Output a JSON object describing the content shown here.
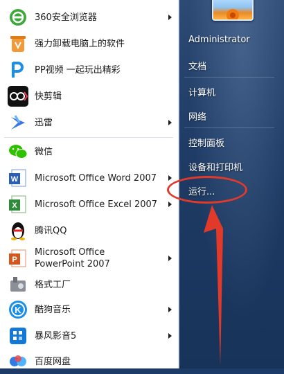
{
  "programs": [
    {
      "label": "360安全浏览器",
      "has_arrow": true
    },
    {
      "label": "强力卸载电脑上的软件",
      "has_arrow": false
    },
    {
      "label": "PP视频 一起玩出精彩",
      "has_arrow": false
    },
    {
      "label": "快剪辑",
      "has_arrow": false
    },
    {
      "label": "迅雷",
      "has_arrow": true
    },
    {
      "label": "微信",
      "has_arrow": false
    },
    {
      "label": "Microsoft Office Word 2007",
      "has_arrow": true
    },
    {
      "label": "Microsoft Office Excel 2007",
      "has_arrow": true
    },
    {
      "label": "腾讯QQ",
      "has_arrow": false
    },
    {
      "label": "Microsoft Office PowerPoint 2007",
      "has_arrow": true
    },
    {
      "label": "格式工厂",
      "has_arrow": false
    },
    {
      "label": "酷狗音乐",
      "has_arrow": true
    },
    {
      "label": "暴风影音5",
      "has_arrow": true
    },
    {
      "label": "百度网盘",
      "has_arrow": false
    }
  ],
  "right_menu": {
    "user": "Administrator",
    "documents": "文档",
    "computer": "计算机",
    "network": "网络",
    "control_panel": "控制面板",
    "devices": "设备和打印机",
    "run": "运行..."
  },
  "annotation_color": "#e23a2a"
}
